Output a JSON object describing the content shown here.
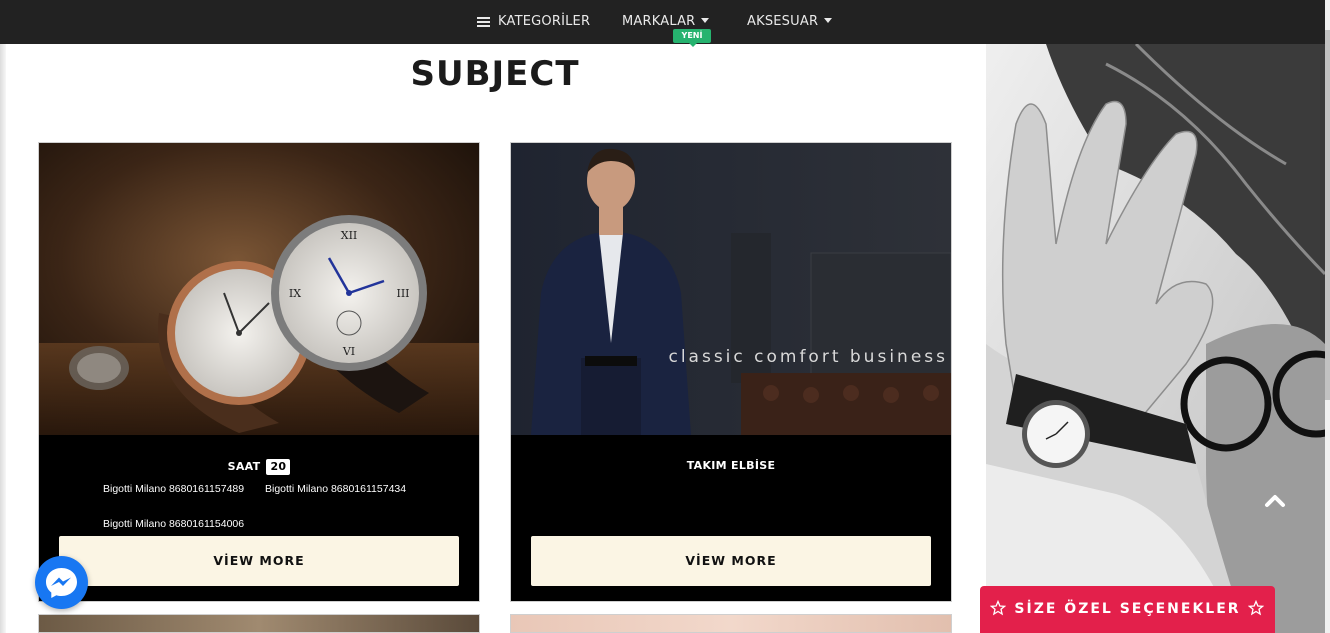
{
  "nav": {
    "categories_label": "KATEGORİLER",
    "brands_label": "MARKALAR",
    "brands_badge": "YENİ",
    "accessories_label": "AKSESUAR"
  },
  "page": {
    "title": "SUBJECT"
  },
  "cards": [
    {
      "title": "SAAT",
      "count": "20",
      "links": [
        "Bigotti Milano 8680161157489",
        "Bigotti Milano 8680161157434",
        "Bigotti Milano 8680161154006"
      ],
      "button_label": "VİEW MORE",
      "image_icon": "watches-photo"
    },
    {
      "title": "TAKIM ELBİSE",
      "image_caption": "classic comfort business",
      "button_label": "VİEW MORE",
      "image_icon": "suit-photo"
    }
  ],
  "floating": {
    "special_options_label": "SİZE ÖZEL SEÇENEKLER",
    "messenger_icon": "messenger-icon",
    "scroll_top_icon": "chevron-up-icon"
  },
  "colors": {
    "nav_bg": "#222222",
    "badge_green": "#26b36f",
    "button_cream": "#fbf5e4",
    "accent_red": "#e3204b",
    "messenger_blue": "#1877f2"
  }
}
